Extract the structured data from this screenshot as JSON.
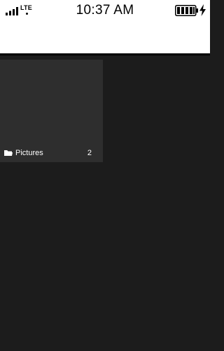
{
  "status_bar": {
    "network": "LTE",
    "time": "10:37 AM",
    "battery_level": 1.0,
    "charging": true,
    "signal_bars": 4
  },
  "gallery": {
    "albums": [
      {
        "name": "Pictures",
        "count": "2",
        "icon": "folder-icon"
      }
    ]
  }
}
